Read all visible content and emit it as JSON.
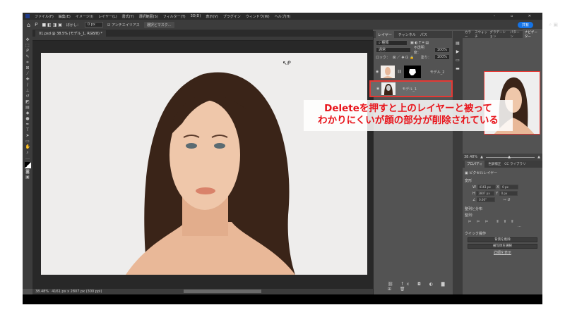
{
  "menu": [
    "ファイル(F)",
    "編集(E)",
    "イメージ(I)",
    "レイヤー(L)",
    "書式(Y)",
    "選択範囲(S)",
    "フィルター(T)",
    "3D(D)",
    "表示(V)",
    "プラグイン",
    "ウィンドウ(W)",
    "ヘルプ(H)"
  ],
  "options": {
    "feather_label": "ぼかし：",
    "feather_value": "0 px",
    "antialias": "アンチエイリアス",
    "mask_button": "選択とマスク...",
    "share": "共有"
  },
  "doc_tab": "01.psd @ 38.5% (モデル_1, RGB/8) *",
  "status": {
    "zoom": "38.48%",
    "info": "4161 px x 2807 px (300 ppi)"
  },
  "layers_panel": {
    "tabs": [
      "レイヤー",
      "チャンネル",
      "パス"
    ],
    "filter": "種類",
    "blend": "通常",
    "opacity_label": "不透明度：",
    "opacity": "100%",
    "lock_label": "ロック：",
    "fill_label": "塗り：",
    "fill": "100%",
    "layers": [
      {
        "name": "モデル_2",
        "selected": false
      },
      {
        "name": "モデル_1",
        "selected": true
      }
    ]
  },
  "right_tabs": [
    "カラー",
    "スウォッチ",
    "グラデーション",
    "パターン",
    "ナビゲーター"
  ],
  "navigator": {
    "zoom": "38.48%"
  },
  "properties": {
    "tabs": [
      "プロパティ",
      "色調補正",
      "CC ライブラリ"
    ],
    "kind": "ピクセルレイヤー",
    "transform": "変形",
    "w": "4161 px",
    "h": "2807 px",
    "x": "0 px",
    "y": "0 px",
    "angle": "0.00°",
    "align": "整列と分布",
    "align_sub": "整列：",
    "quick": "クイック操作",
    "btn1": "背景を削除",
    "btn2": "被写体を選択",
    "more": "詳細を表示"
  },
  "annotation": {
    "line1": "Deleteを押すと上のレイヤーと被って",
    "line2": "わかりにくいが顔の部分が削除されている"
  },
  "colors": {
    "accent": "#1473e6",
    "annotation": "#e8141b"
  }
}
